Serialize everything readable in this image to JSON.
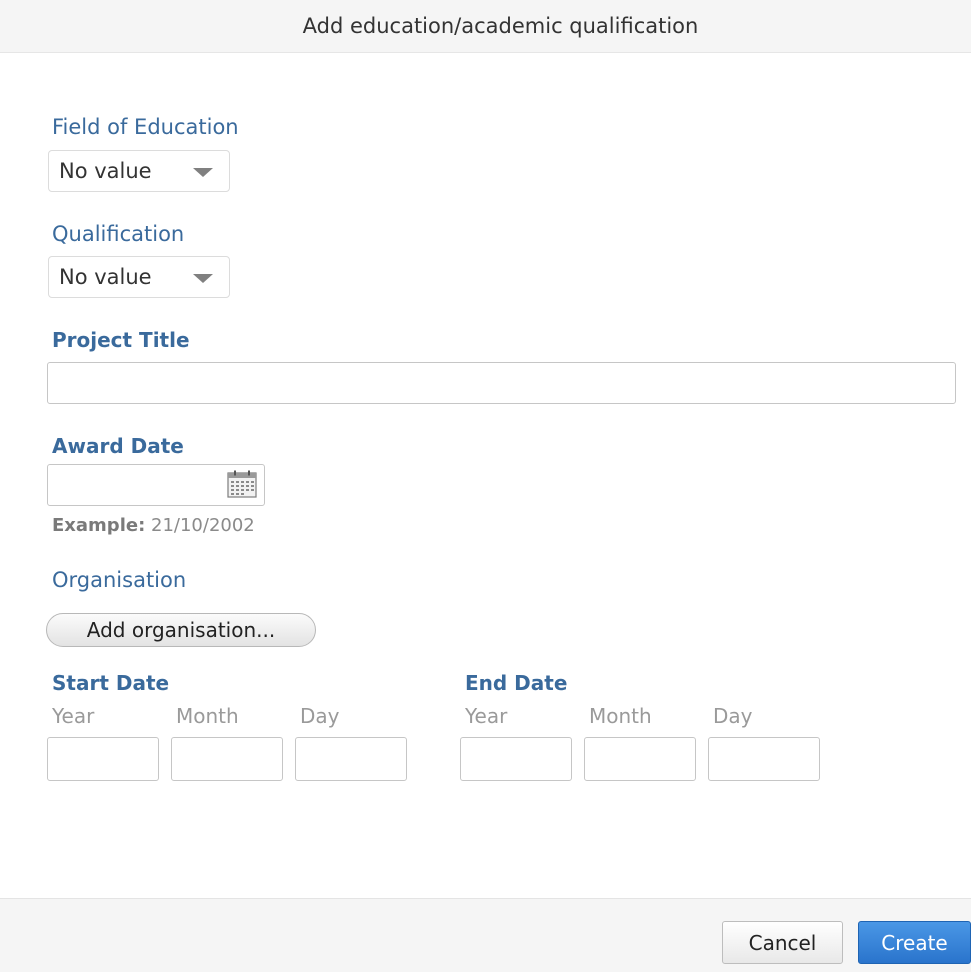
{
  "dialog": {
    "title": "Add education/academic qualification"
  },
  "field_of_education": {
    "label": "Field of Education",
    "value": "No value"
  },
  "qualification": {
    "label": "Qualification",
    "value": "No value"
  },
  "project_title": {
    "label": "Project Title",
    "value": "",
    "placeholder": ""
  },
  "award_date": {
    "label": "Award Date",
    "value": "",
    "example_prefix": "Example:",
    "example_value": "21/10/2002"
  },
  "organisation": {
    "label": "Organisation",
    "button_label": "Add organisation..."
  },
  "start_date": {
    "label": "Start Date",
    "year_label": "Year",
    "month_label": "Month",
    "day_label": "Day"
  },
  "end_date": {
    "label": "End Date",
    "year_label": "Year",
    "month_label": "Month",
    "day_label": "Day"
  },
  "footer": {
    "cancel_label": "Cancel",
    "create_label": "Create"
  },
  "icons": {
    "select_caret": "chevron-down-icon",
    "calendar": "calendar-icon"
  },
  "colors": {
    "label_blue": "#3a6a9c",
    "primary_button": "#2a74cc",
    "hint_gray": "#9a9a9a"
  }
}
